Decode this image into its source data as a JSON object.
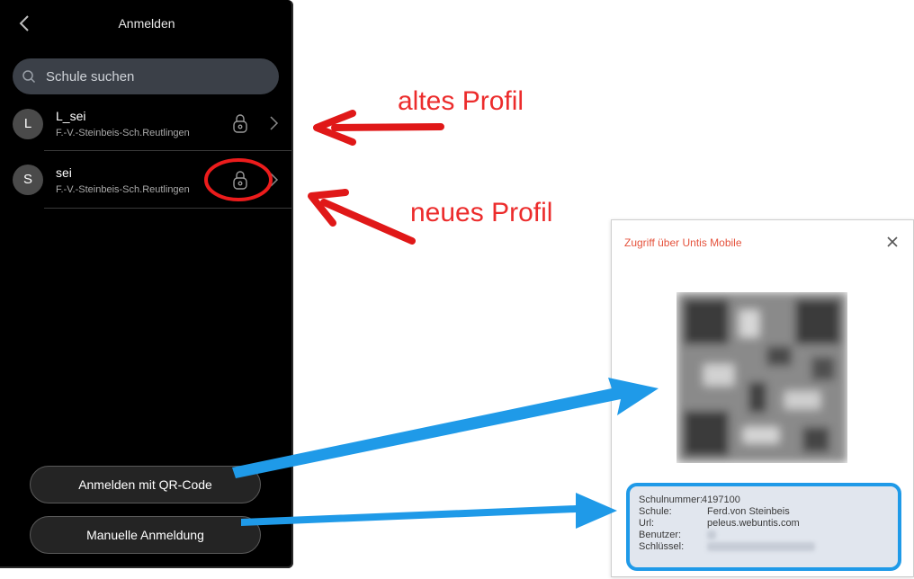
{
  "app": {
    "title": "Anmelden",
    "search_placeholder": "Schule suchen",
    "profiles": [
      {
        "initial": "L",
        "name": "L_sei",
        "school": "F.-V.-Steinbeis-Sch.Reutlingen"
      },
      {
        "initial": "S",
        "name": "sei",
        "school": "F.-V.-Steinbeis-Sch.Reutlingen"
      }
    ],
    "qr_button": "Anmelden mit QR-Code",
    "manual_button": "Manuelle Anmeldung"
  },
  "annotations": {
    "old_profile": "altes Profil",
    "new_profile": "neues Profil"
  },
  "dialog": {
    "title": "Zugriff über Untis Mobile",
    "fields": {
      "schulnummer_label": "Schulnummer:",
      "schulnummer_value": "4197100",
      "schule_label": "Schule:",
      "schule_value": "Ferd.von Steinbeis",
      "url_label": "Url:",
      "url_value": "peleus.webuntis.com",
      "benutzer_label": "Benutzer:",
      "schluessel_label": "Schlüssel:"
    }
  },
  "colors": {
    "annotation_red": "#ec2c2c",
    "arrow_blue": "#1f9ae8",
    "dialog_title": "#e5533d",
    "phone_bg": "#000000"
  },
  "icons": [
    "back-chevron-icon",
    "search-icon",
    "lock-icon",
    "chevron-right-icon",
    "close-icon",
    "qr-code-icon"
  ]
}
